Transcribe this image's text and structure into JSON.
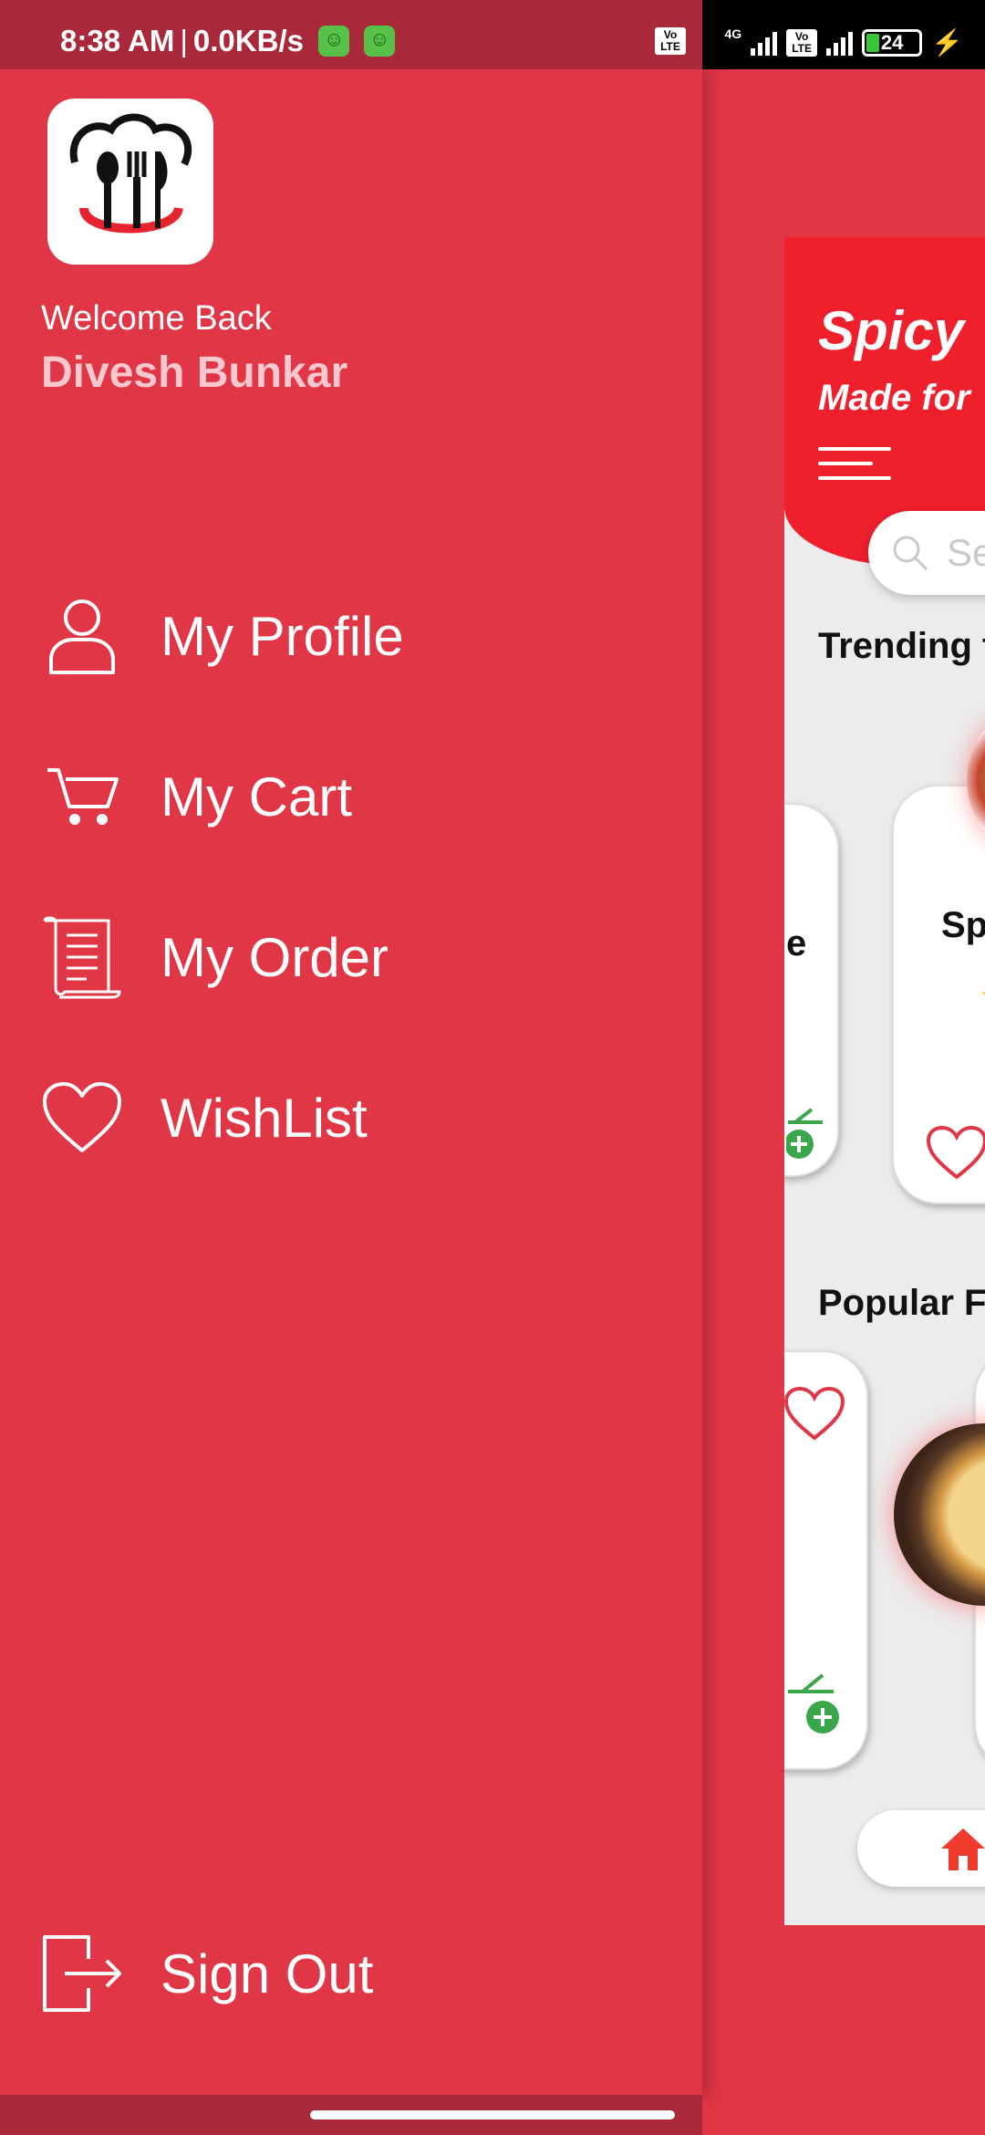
{
  "status_bar": {
    "time": "8:38 AM",
    "separator": "|",
    "speed": "0.0KB/s",
    "net_label": "4G",
    "volte_label": "Vo\nLTE",
    "battery": "24"
  },
  "drawer": {
    "welcome": "Welcome Back",
    "user_name": "Divesh Bunkar",
    "menu": [
      {
        "label": "My Profile",
        "icon": "user-icon"
      },
      {
        "label": "My Cart",
        "icon": "cart-icon"
      },
      {
        "label": "My Order",
        "icon": "receipt-icon"
      },
      {
        "label": "WishList",
        "icon": "heart-icon"
      }
    ],
    "sign_out": {
      "label": "Sign Out",
      "icon": "sign-out-icon"
    }
  },
  "background_app": {
    "title": "Spicy",
    "subtitle": "Made for",
    "search_placeholder": "Se",
    "section_trending": "Trending t",
    "section_popular": "Popular Fo",
    "card_left_text": "e",
    "card_right_text": "Spi"
  },
  "colors": {
    "drawer_bg": "#e03645",
    "status_bg": "#a9283a",
    "header_red": "#ef1f2c",
    "accent_green": "#3aa84a"
  }
}
